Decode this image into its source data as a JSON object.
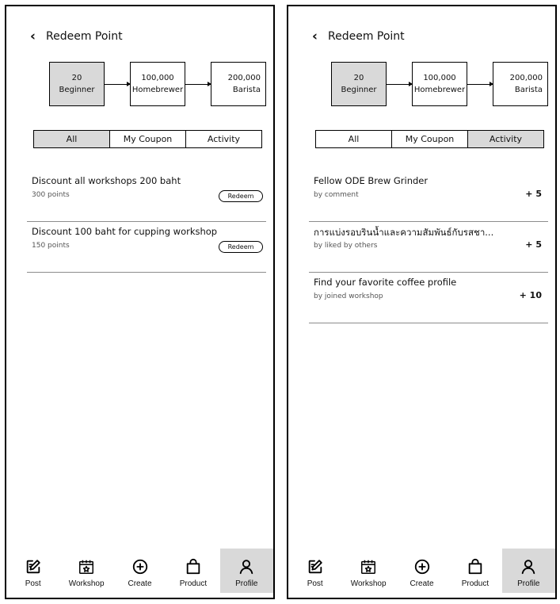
{
  "left": {
    "title": "Redeem Point",
    "levels": [
      {
        "points": "20",
        "name": "Beginner",
        "active": true
      },
      {
        "points": "100,000",
        "name": "Homebrewer",
        "active": false
      },
      {
        "points": "200,000",
        "name": "Barista",
        "active": false
      }
    ],
    "tabs": [
      {
        "label": "All",
        "active": true
      },
      {
        "label": "My Coupon",
        "active": false
      },
      {
        "label": "Activity",
        "active": false
      }
    ],
    "items": [
      {
        "title": "Discount all workshops 200 baht",
        "subtitle": "300 points",
        "action": "Redeem"
      },
      {
        "title": "Discount 100 baht for cupping workshop",
        "subtitle": "150 points",
        "action": "Redeem"
      }
    ],
    "nav": [
      {
        "label": "Post",
        "icon": "post-icon",
        "active": false
      },
      {
        "label": "Workshop",
        "icon": "calendar-star-icon",
        "active": false
      },
      {
        "label": "Create",
        "icon": "plus-circle-icon",
        "active": false
      },
      {
        "label": "Product",
        "icon": "shopping-bag-icon",
        "active": false
      },
      {
        "label": "Profile",
        "icon": "user-icon",
        "active": true
      }
    ]
  },
  "right": {
    "title": "Redeem Point",
    "levels": [
      {
        "points": "20",
        "name": "Beginner",
        "active": true
      },
      {
        "points": "100,000",
        "name": "Homebrewer",
        "active": false
      },
      {
        "points": "200,000",
        "name": "Barista",
        "active": false
      }
    ],
    "tabs": [
      {
        "label": "All",
        "active": false
      },
      {
        "label": "My Coupon",
        "active": false
      },
      {
        "label": "Activity",
        "active": true
      }
    ],
    "items": [
      {
        "title": "Fellow ODE Brew Grinder",
        "subtitle": "by comment",
        "points": "+ 5"
      },
      {
        "title": "การแบ่งรอบรินน้ำและความสัมพันธ์กับรสชา...",
        "subtitle": "by liked by others",
        "points": "+ 5"
      },
      {
        "title": "Find your favorite coffee profile",
        "subtitle": "by joined workshop",
        "points": "+ 10"
      }
    ],
    "nav": [
      {
        "label": "Post",
        "icon": "post-icon",
        "active": false
      },
      {
        "label": "Workshop",
        "icon": "calendar-star-icon",
        "active": false
      },
      {
        "label": "Create",
        "icon": "plus-circle-icon",
        "active": false
      },
      {
        "label": "Product",
        "icon": "shopping-bag-icon",
        "active": false
      },
      {
        "label": "Profile",
        "icon": "user-icon",
        "active": true
      }
    ]
  },
  "colors": {
    "selected": "#d9d9d9",
    "border": "#000000",
    "divider": "#8c8c8c"
  }
}
